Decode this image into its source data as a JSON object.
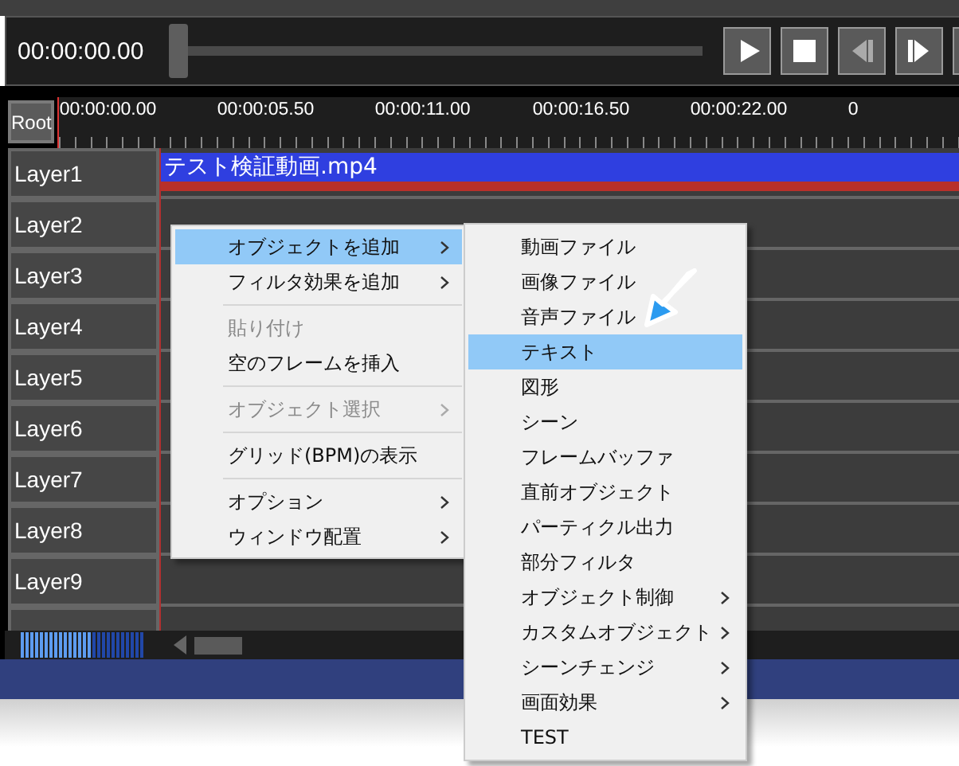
{
  "player": {
    "time": "00:00:00.00",
    "seek": {
      "level": 0
    },
    "buttons": [
      {
        "kind": "play"
      },
      {
        "kind": "stop"
      },
      {
        "kind": "prev"
      },
      {
        "kind": "next"
      },
      {
        "kind": "more"
      }
    ]
  },
  "timeline": {
    "root_button": "Root",
    "ruler_labels": [
      "00:00:00.00",
      "00:00:05.50",
      "00:00:11.00",
      "00:00:16.50",
      "00:00:22.00",
      "0"
    ],
    "layers": [
      {
        "name": "Layer1",
        "clip": "テスト検証動画.mp4"
      },
      {
        "name": "Layer2"
      },
      {
        "name": "Layer3"
      },
      {
        "name": "Layer4"
      },
      {
        "name": "Layer5"
      },
      {
        "name": "Layer6"
      },
      {
        "name": "Layer7"
      },
      {
        "name": "Layer8"
      },
      {
        "name": "Layer9"
      }
    ],
    "zoom": {
      "level": 0.58
    }
  },
  "context_menu": {
    "items": [
      {
        "kind": "item",
        "label": "オブジェクトを追加",
        "selected": true,
        "disabled": false,
        "submenu": true
      },
      {
        "kind": "item",
        "label": "フィルタ効果を追加",
        "selected": false,
        "disabled": false,
        "submenu": true
      },
      {
        "kind": "separator"
      },
      {
        "kind": "item",
        "label": "貼り付け",
        "selected": false,
        "disabled": true,
        "submenu": false
      },
      {
        "kind": "item",
        "label": "空のフレームを挿入",
        "selected": false,
        "disabled": false,
        "submenu": false
      },
      {
        "kind": "separator"
      },
      {
        "kind": "item",
        "label": "オブジェクト選択",
        "selected": false,
        "disabled": true,
        "submenu": true
      },
      {
        "kind": "separator"
      },
      {
        "kind": "item",
        "label": "グリッド(BPM)の表示",
        "selected": false,
        "disabled": false,
        "submenu": false
      },
      {
        "kind": "separator"
      },
      {
        "kind": "item",
        "label": "オプション",
        "selected": false,
        "disabled": false,
        "submenu": true
      },
      {
        "kind": "item",
        "label": "ウィンドウ配置",
        "selected": false,
        "disabled": false,
        "submenu": true
      }
    ]
  },
  "submenu": {
    "items": [
      {
        "kind": "item",
        "label": "動画ファイル",
        "selected": false,
        "disabled": false,
        "submenu": false
      },
      {
        "kind": "item",
        "label": "画像ファイル",
        "selected": false,
        "disabled": false,
        "submenu": false
      },
      {
        "kind": "item",
        "label": "音声ファイル",
        "selected": false,
        "disabled": false,
        "submenu": false
      },
      {
        "kind": "item",
        "label": "テキスト",
        "selected": true,
        "disabled": false,
        "submenu": false
      },
      {
        "kind": "item",
        "label": "図形",
        "selected": false,
        "disabled": false,
        "submenu": false
      },
      {
        "kind": "item",
        "label": "シーン",
        "selected": false,
        "disabled": false,
        "submenu": false
      },
      {
        "kind": "item",
        "label": "フレームバッファ",
        "selected": false,
        "disabled": false,
        "submenu": false
      },
      {
        "kind": "item",
        "label": "直前オブジェクト",
        "selected": false,
        "disabled": false,
        "submenu": false
      },
      {
        "kind": "item",
        "label": "パーティクル出力",
        "selected": false,
        "disabled": false,
        "submenu": false
      },
      {
        "kind": "item",
        "label": "部分フィルタ",
        "selected": false,
        "disabled": false,
        "submenu": false
      },
      {
        "kind": "item",
        "label": "オブジェクト制御",
        "selected": false,
        "disabled": false,
        "submenu": true
      },
      {
        "kind": "item",
        "label": "カスタムオブジェクト",
        "selected": false,
        "disabled": false,
        "submenu": true
      },
      {
        "kind": "item",
        "label": "シーンチェンジ",
        "selected": false,
        "disabled": false,
        "submenu": true
      },
      {
        "kind": "item",
        "label": "画面効果",
        "selected": false,
        "disabled": false,
        "submenu": true
      },
      {
        "kind": "item",
        "label": "TEST",
        "selected": false,
        "disabled": false,
        "submenu": false
      }
    ]
  }
}
